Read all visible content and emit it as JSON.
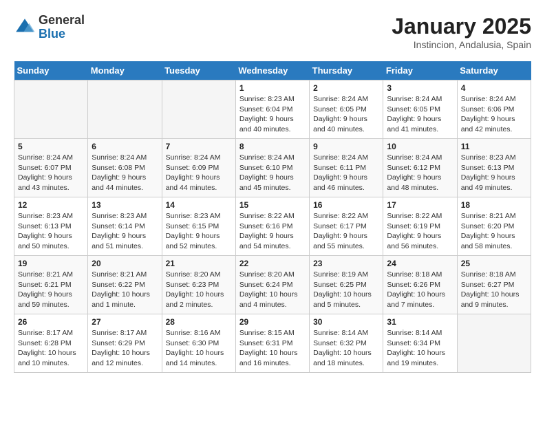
{
  "header": {
    "logo_general": "General",
    "logo_blue": "Blue",
    "month_title": "January 2025",
    "subtitle": "Instincion, Andalusia, Spain"
  },
  "weekdays": [
    "Sunday",
    "Monday",
    "Tuesday",
    "Wednesday",
    "Thursday",
    "Friday",
    "Saturday"
  ],
  "weeks": [
    [
      {
        "day": "",
        "info": ""
      },
      {
        "day": "",
        "info": ""
      },
      {
        "day": "",
        "info": ""
      },
      {
        "day": "1",
        "info": "Sunrise: 8:23 AM\nSunset: 6:04 PM\nDaylight: 9 hours\nand 40 minutes."
      },
      {
        "day": "2",
        "info": "Sunrise: 8:24 AM\nSunset: 6:05 PM\nDaylight: 9 hours\nand 40 minutes."
      },
      {
        "day": "3",
        "info": "Sunrise: 8:24 AM\nSunset: 6:05 PM\nDaylight: 9 hours\nand 41 minutes."
      },
      {
        "day": "4",
        "info": "Sunrise: 8:24 AM\nSunset: 6:06 PM\nDaylight: 9 hours\nand 42 minutes."
      }
    ],
    [
      {
        "day": "5",
        "info": "Sunrise: 8:24 AM\nSunset: 6:07 PM\nDaylight: 9 hours\nand 43 minutes."
      },
      {
        "day": "6",
        "info": "Sunrise: 8:24 AM\nSunset: 6:08 PM\nDaylight: 9 hours\nand 44 minutes."
      },
      {
        "day": "7",
        "info": "Sunrise: 8:24 AM\nSunset: 6:09 PM\nDaylight: 9 hours\nand 44 minutes."
      },
      {
        "day": "8",
        "info": "Sunrise: 8:24 AM\nSunset: 6:10 PM\nDaylight: 9 hours\nand 45 minutes."
      },
      {
        "day": "9",
        "info": "Sunrise: 8:24 AM\nSunset: 6:11 PM\nDaylight: 9 hours\nand 46 minutes."
      },
      {
        "day": "10",
        "info": "Sunrise: 8:24 AM\nSunset: 6:12 PM\nDaylight: 9 hours\nand 48 minutes."
      },
      {
        "day": "11",
        "info": "Sunrise: 8:23 AM\nSunset: 6:13 PM\nDaylight: 9 hours\nand 49 minutes."
      }
    ],
    [
      {
        "day": "12",
        "info": "Sunrise: 8:23 AM\nSunset: 6:13 PM\nDaylight: 9 hours\nand 50 minutes."
      },
      {
        "day": "13",
        "info": "Sunrise: 8:23 AM\nSunset: 6:14 PM\nDaylight: 9 hours\nand 51 minutes."
      },
      {
        "day": "14",
        "info": "Sunrise: 8:23 AM\nSunset: 6:15 PM\nDaylight: 9 hours\nand 52 minutes."
      },
      {
        "day": "15",
        "info": "Sunrise: 8:22 AM\nSunset: 6:16 PM\nDaylight: 9 hours\nand 54 minutes."
      },
      {
        "day": "16",
        "info": "Sunrise: 8:22 AM\nSunset: 6:17 PM\nDaylight: 9 hours\nand 55 minutes."
      },
      {
        "day": "17",
        "info": "Sunrise: 8:22 AM\nSunset: 6:19 PM\nDaylight: 9 hours\nand 56 minutes."
      },
      {
        "day": "18",
        "info": "Sunrise: 8:21 AM\nSunset: 6:20 PM\nDaylight: 9 hours\nand 58 minutes."
      }
    ],
    [
      {
        "day": "19",
        "info": "Sunrise: 8:21 AM\nSunset: 6:21 PM\nDaylight: 9 hours\nand 59 minutes."
      },
      {
        "day": "20",
        "info": "Sunrise: 8:21 AM\nSunset: 6:22 PM\nDaylight: 10 hours\nand 1 minute."
      },
      {
        "day": "21",
        "info": "Sunrise: 8:20 AM\nSunset: 6:23 PM\nDaylight: 10 hours\nand 2 minutes."
      },
      {
        "day": "22",
        "info": "Sunrise: 8:20 AM\nSunset: 6:24 PM\nDaylight: 10 hours\nand 4 minutes."
      },
      {
        "day": "23",
        "info": "Sunrise: 8:19 AM\nSunset: 6:25 PM\nDaylight: 10 hours\nand 5 minutes."
      },
      {
        "day": "24",
        "info": "Sunrise: 8:18 AM\nSunset: 6:26 PM\nDaylight: 10 hours\nand 7 minutes."
      },
      {
        "day": "25",
        "info": "Sunrise: 8:18 AM\nSunset: 6:27 PM\nDaylight: 10 hours\nand 9 minutes."
      }
    ],
    [
      {
        "day": "26",
        "info": "Sunrise: 8:17 AM\nSunset: 6:28 PM\nDaylight: 10 hours\nand 10 minutes."
      },
      {
        "day": "27",
        "info": "Sunrise: 8:17 AM\nSunset: 6:29 PM\nDaylight: 10 hours\nand 12 minutes."
      },
      {
        "day": "28",
        "info": "Sunrise: 8:16 AM\nSunset: 6:30 PM\nDaylight: 10 hours\nand 14 minutes."
      },
      {
        "day": "29",
        "info": "Sunrise: 8:15 AM\nSunset: 6:31 PM\nDaylight: 10 hours\nand 16 minutes."
      },
      {
        "day": "30",
        "info": "Sunrise: 8:14 AM\nSunset: 6:32 PM\nDaylight: 10 hours\nand 18 minutes."
      },
      {
        "day": "31",
        "info": "Sunrise: 8:14 AM\nSunset: 6:34 PM\nDaylight: 10 hours\nand 19 minutes."
      },
      {
        "day": "",
        "info": ""
      }
    ]
  ]
}
